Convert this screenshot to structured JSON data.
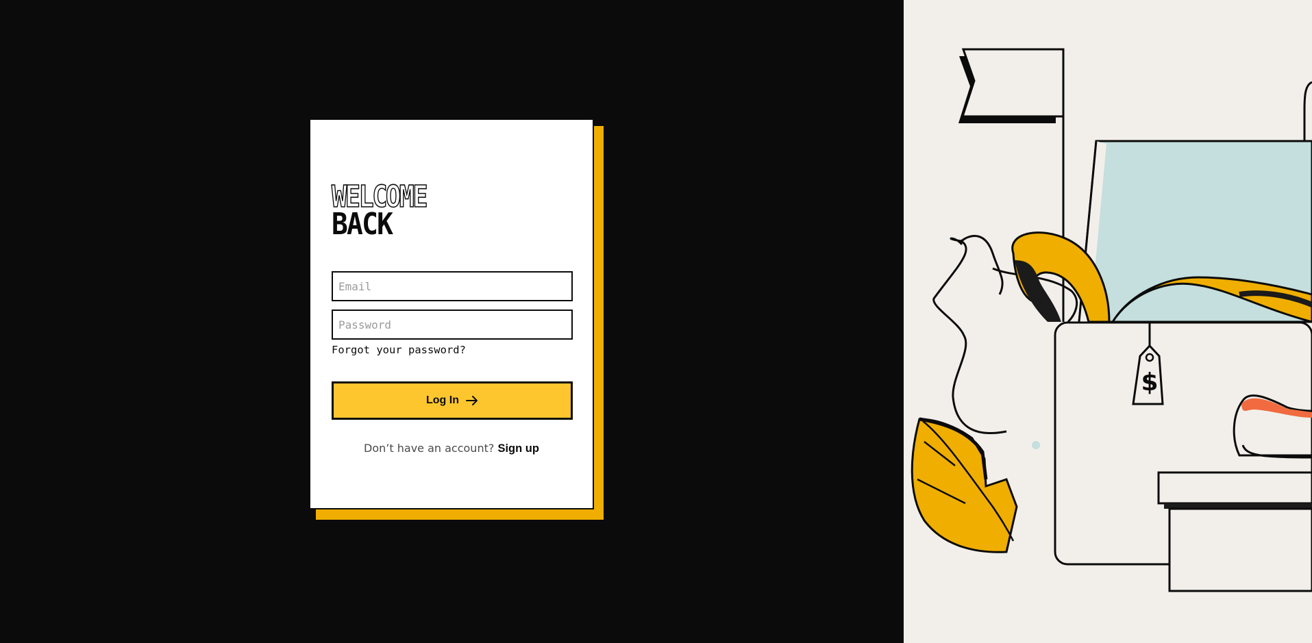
{
  "login_card": {
    "title_line1": "WELCOME",
    "title_line2": "BACK",
    "email_placeholder": "Email",
    "email_value": "",
    "password_placeholder": "Password",
    "password_value": "",
    "forgot_password_label": "Forgot your password?",
    "login_button_label": "Log In",
    "login_button_icon": "arrow-right-icon",
    "signup_prompt": "Don’t have an account?",
    "signup_link_label": "Sign up"
  },
  "illustration": {
    "price_tag_symbol": "$",
    "description_icons": [
      "flag-icon",
      "price-tag-icon",
      "gift-box-icon",
      "leaf-icon",
      "ribbon-icon"
    ]
  },
  "colors": {
    "background": "#0b0b0b",
    "accent_yellow": "#fec62e",
    "shadow_yellow": "#efae00",
    "panel_cream": "#f2efeb",
    "illustration_blue": "#c5dede",
    "illustration_orange": "#f06b3f"
  }
}
